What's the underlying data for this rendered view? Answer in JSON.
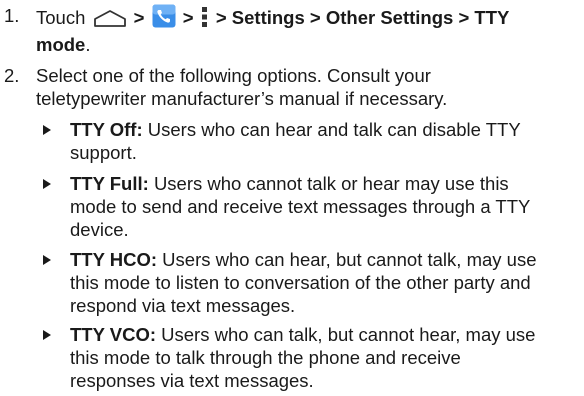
{
  "steps": [
    {
      "number": "1.",
      "touch": "Touch",
      "sep1": ">",
      "sep2": ">",
      "path_rest": "> Settings > Other Settings > TTY",
      "path_end": "mode",
      "period": ".",
      "icons": [
        "home-icon",
        "phone-icon",
        "menu-icon"
      ],
      "icon_colors": {
        "home": "#333333",
        "phone": "#3a8ee8"
      }
    },
    {
      "number": "2.",
      "line1": "Select one of the following options. Consult your",
      "line2": "teletypewriter manufacturer’s manual if necessary."
    }
  ],
  "options": [
    {
      "term": "TTY Off:",
      "lines": [
        "Users who can hear and talk can disable TTY",
        "support."
      ]
    },
    {
      "term": "TTY Full:",
      "lines": [
        "Users who cannot talk or hear may use this",
        "mode to send and receive text messages through a TTY",
        "device."
      ]
    },
    {
      "term": "TTY HCO:",
      "lines": [
        "Users who can hear, but cannot talk, may use",
        "this mode to listen to conversation of the other party and",
        "respond via text messages."
      ]
    },
    {
      "term": "TTY VCO:",
      "lines": [
        "Users who can talk, but cannot hear, may use",
        "this mode to talk through the phone and receive",
        "responses via text messages."
      ]
    }
  ]
}
